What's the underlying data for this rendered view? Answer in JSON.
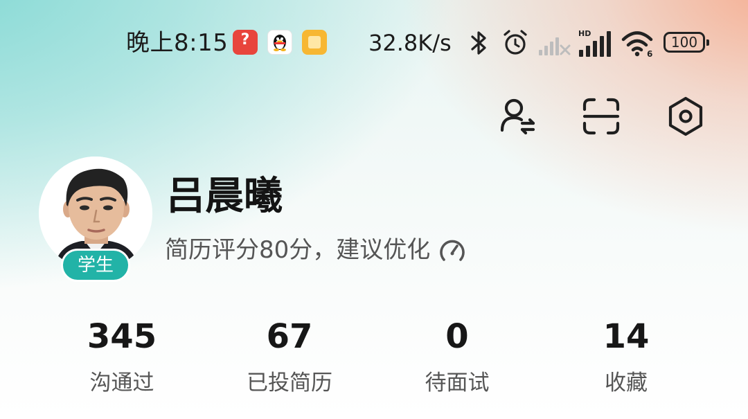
{
  "status_bar": {
    "time": "晚上8:15",
    "network_speed": "32.8K/s",
    "battery_level": "100",
    "signal_label": "HD",
    "wifi_label": "6",
    "notification_icons": [
      "help-app-icon",
      "qq-icon",
      "notes-app-icon"
    ],
    "system_icons": [
      "bluetooth-icon",
      "alarm-icon",
      "signal-off-icon",
      "signal-icon",
      "wifi-icon",
      "battery-icon"
    ]
  },
  "toolbar": {
    "icons": [
      "switch-account-icon",
      "scan-icon",
      "settings-icon"
    ]
  },
  "profile": {
    "name": "吕晨曦",
    "role_badge": "学生",
    "resume_score_text": "简历评分80分，建议优化",
    "resume_score": 80
  },
  "stats": [
    {
      "value": "345",
      "label": "沟通过"
    },
    {
      "value": "67",
      "label": "已投简历"
    },
    {
      "value": "0",
      "label": "待面试"
    },
    {
      "value": "14",
      "label": "收藏"
    }
  ],
  "colors": {
    "accent": "#22b3a7",
    "gradient_left": "#7dd7d2",
    "gradient_right": "#f6aa8c",
    "text_primary": "#141414",
    "text_secondary": "#555555"
  }
}
